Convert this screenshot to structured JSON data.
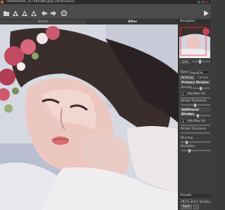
{
  "window": {
    "title": "- AdobeStock_147384388.jpeg (3456x2622)"
  },
  "tabs": {
    "before": "Before",
    "after": "After"
  },
  "panel": {
    "navigator_title": "Navigator",
    "zoom_value": "100%",
    "style_label": "Style:",
    "style_value": "Gouache",
    "subtab_painting": "Painting",
    "subtab_canvas": "Canvas",
    "primary_strokes": "Primary Strokes",
    "density_label": "Density",
    "minmax_value": "1",
    "minmax_label": "Min/Max Str",
    "stroke_thickness": "Stroke Thickness",
    "additional_strokes": "Additional Strokes",
    "density2_label": "Density",
    "minmax2_value": "1",
    "minmax2_label": "Min/Max Str",
    "stroke_thickness2": "Stroke Thickness",
    "blurring": "Blurring",
    "deviation": "Deviation",
    "presets_title": "Presets",
    "preset_value": "AKVIS Short Strokes",
    "save_label": "Save"
  },
  "colors": {
    "panel_bg": "#3d3d3d",
    "toolbar_bg": "#4b4b4b",
    "accent": "#c96b2a"
  }
}
